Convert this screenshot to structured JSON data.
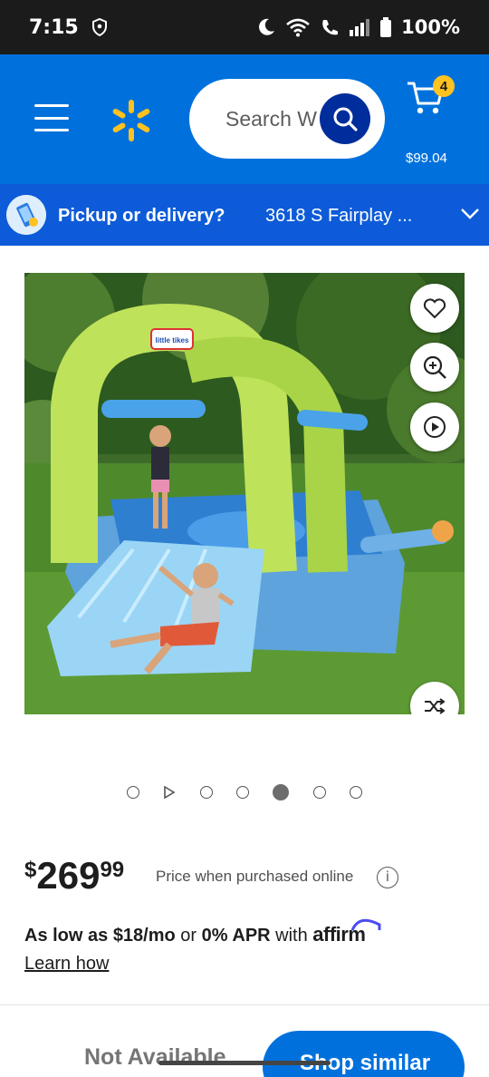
{
  "status_bar": {
    "time": "7:15",
    "battery": "100%",
    "icons": [
      "shield-icon",
      "moon-icon",
      "wifi-icon",
      "wifi-calling-icon",
      "signal-icon",
      "battery-icon"
    ]
  },
  "header": {
    "search_text": "Search Walmart",
    "search_placeholder": "Search W",
    "cart_count": "4",
    "cart_total": "$99.04",
    "colors": {
      "header_bg": "#0071dc",
      "spark": "#ffc220",
      "search_button": "#002d9c"
    }
  },
  "pickup": {
    "label": "Pickup or delivery?",
    "address": "3618 S Fairplay ..."
  },
  "product": {
    "image_description_icon": "bounce-house-image",
    "brand_text": "little tikes",
    "image_buttons": [
      "heart-icon",
      "zoom-in-icon",
      "play-icon",
      "shuffle-icon"
    ],
    "carousel": {
      "items": [
        "dot",
        "video",
        "dot",
        "dot",
        "dot-active",
        "dot",
        "dot"
      ]
    }
  },
  "price": {
    "symbol": "$",
    "dollars": "269",
    "cents": "99",
    "note": "Price when purchased online"
  },
  "financing": {
    "prefix": "As low as $18/mo",
    "or": " or ",
    "apr": "0% APR",
    "with": " with ",
    "provider": "affirm",
    "learn_how": "Learn how"
  },
  "actions": {
    "not_available": "Not Available",
    "shop_similar": "Shop similar"
  }
}
